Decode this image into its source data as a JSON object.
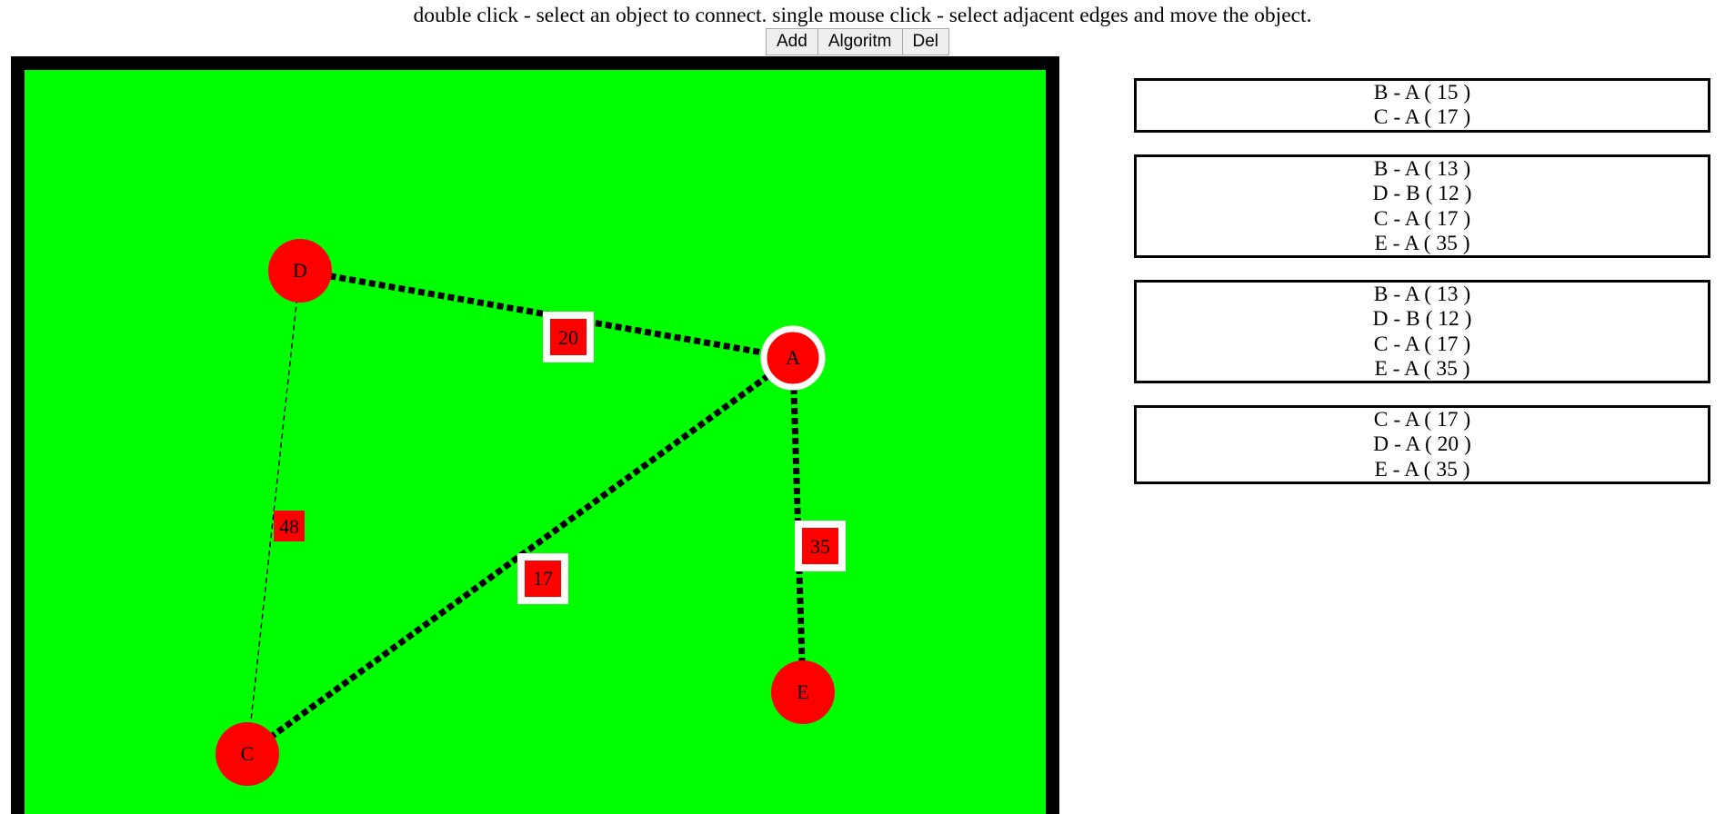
{
  "instructions": "double click - select an object to connect. single mouse click - select adjacent edges and move the object.",
  "toolbar": {
    "add_label": "Add",
    "algorithm_label": "Algoritm",
    "delete_label": "Del"
  },
  "colors": {
    "canvas_background": "#00ff00",
    "canvas_border": "#000000",
    "node_fill": "#ff0000",
    "selected_outline": "#ffffff",
    "edge_color": "#000000"
  },
  "graph": {
    "nodes": [
      {
        "id": "D",
        "label": "D",
        "selected": false
      },
      {
        "id": "A",
        "label": "A",
        "selected": true
      },
      {
        "id": "C",
        "label": "C",
        "selected": false
      },
      {
        "id": "E",
        "label": "E",
        "selected": false
      }
    ],
    "edges": [
      {
        "from": "D",
        "to": "A",
        "weight": "20",
        "style": "selected"
      },
      {
        "from": "A",
        "to": "C",
        "weight": "17",
        "style": "selected"
      },
      {
        "from": "A",
        "to": "E",
        "weight": "35",
        "style": "selected"
      },
      {
        "from": "D",
        "to": "C",
        "weight": "48",
        "style": "normal"
      }
    ]
  },
  "results": [
    [
      "B - A ( 15 )",
      "C - A ( 17 )"
    ],
    [
      "B - A ( 13 )",
      "D - B ( 12 )",
      "C - A ( 17 )",
      "E - A ( 35 )"
    ],
    [
      "B - A ( 13 )",
      "D - B ( 12 )",
      "C - A ( 17 )",
      "E - A ( 35 )"
    ],
    [
      "C - A ( 17 )",
      "D - A ( 20 )",
      "E - A ( 35 )"
    ]
  ]
}
